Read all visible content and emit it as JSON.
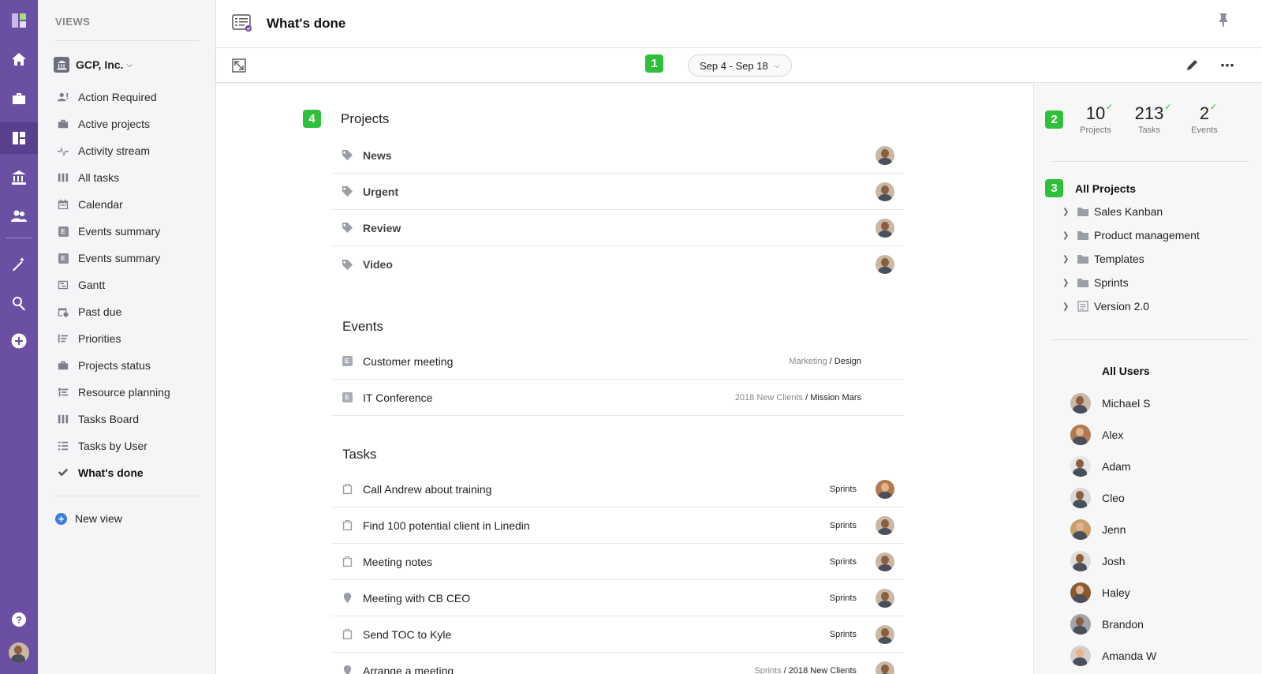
{
  "sidebar": {
    "heading": "VIEWS",
    "org_name": "GCP, Inc.",
    "items": [
      {
        "label": "Action Required",
        "icon": "user-alert-icon"
      },
      {
        "label": "Active projects",
        "icon": "briefcase-icon"
      },
      {
        "label": "Activity stream",
        "icon": "pulse-icon"
      },
      {
        "label": "All tasks",
        "icon": "columns-icon"
      },
      {
        "label": "Calendar",
        "icon": "calendar-icon"
      },
      {
        "label": "Events summary",
        "icon": "event-badge-icon"
      },
      {
        "label": "Events summary",
        "icon": "event-badge-icon"
      },
      {
        "label": "Gantt",
        "icon": "gantt-icon"
      },
      {
        "label": "Past due",
        "icon": "clock-calendar-icon"
      },
      {
        "label": "Priorities",
        "icon": "list-priority-icon"
      },
      {
        "label": "Projects status",
        "icon": "briefcase-icon"
      },
      {
        "label": "Resource planning",
        "icon": "resource-icon"
      },
      {
        "label": "Tasks Board",
        "icon": "columns-icon"
      },
      {
        "label": "Tasks by User",
        "icon": "user-list-icon"
      },
      {
        "label": "What's done",
        "icon": "checkmark-icon"
      }
    ],
    "new_view": "New view"
  },
  "header": {
    "title": "What's done"
  },
  "toolbar": {
    "date_range": "Sep 4 - Sep 18",
    "badge1": "1"
  },
  "main": {
    "projects_badge": "4",
    "projects_title": "Projects",
    "projects": [
      "News",
      "Urgent",
      "Review",
      "Video"
    ],
    "events_title": "Events",
    "events": [
      {
        "label": "Customer meeting",
        "path": "Marketing",
        "path_end": "/ Design"
      },
      {
        "label": "IT Conference",
        "path": "2018 New Clients",
        "path_end": "/ Mission Mars"
      }
    ],
    "tasks_title": "Tasks",
    "tasks": [
      {
        "label": "Call Andrew about training",
        "project": "Sprints",
        "icon": "clipboard-icon"
      },
      {
        "label": "Find 100 potential client in Linedin",
        "project": "Sprints",
        "icon": "clipboard-icon"
      },
      {
        "label": "Meeting notes",
        "project": "Sprints",
        "icon": "clipboard-icon"
      },
      {
        "label": "Meeting with CB CEO",
        "project": "Sprints",
        "icon": "location-pin-icon"
      },
      {
        "label": "Send TOC to Kyle",
        "project": "Sprints",
        "icon": "clipboard-icon"
      },
      {
        "label": "Arrange a meeting",
        "project": "Sprints",
        "project_end": "/ 2018 New Clients",
        "icon": "location-pin-icon"
      }
    ]
  },
  "panel": {
    "stats_badge": "2",
    "stats": [
      {
        "value": "10",
        "label": "Projects"
      },
      {
        "value": "213",
        "label": "Tasks"
      },
      {
        "value": "2",
        "label": "Events"
      }
    ],
    "tree_badge": "3",
    "tree_title": "All Projects",
    "tree": [
      {
        "label": "Sales Kanban",
        "icon": "folder-icon"
      },
      {
        "label": "Product management",
        "icon": "folder-icon"
      },
      {
        "label": "Templates",
        "icon": "folder-icon"
      },
      {
        "label": "Sprints",
        "icon": "folder-icon"
      },
      {
        "label": "Version 2.0",
        "icon": "list-doc-icon"
      }
    ],
    "users_title": "All Users",
    "users": [
      "Michael S",
      "Alex",
      "Adam",
      "Cleo",
      "Jenn",
      "Josh",
      "Haley",
      "Brandon",
      "Amanda W"
    ]
  },
  "colors": {
    "rail": "#6b4fa3",
    "badge": "#2fbf3a",
    "accent_blue": "#3b7de0"
  }
}
